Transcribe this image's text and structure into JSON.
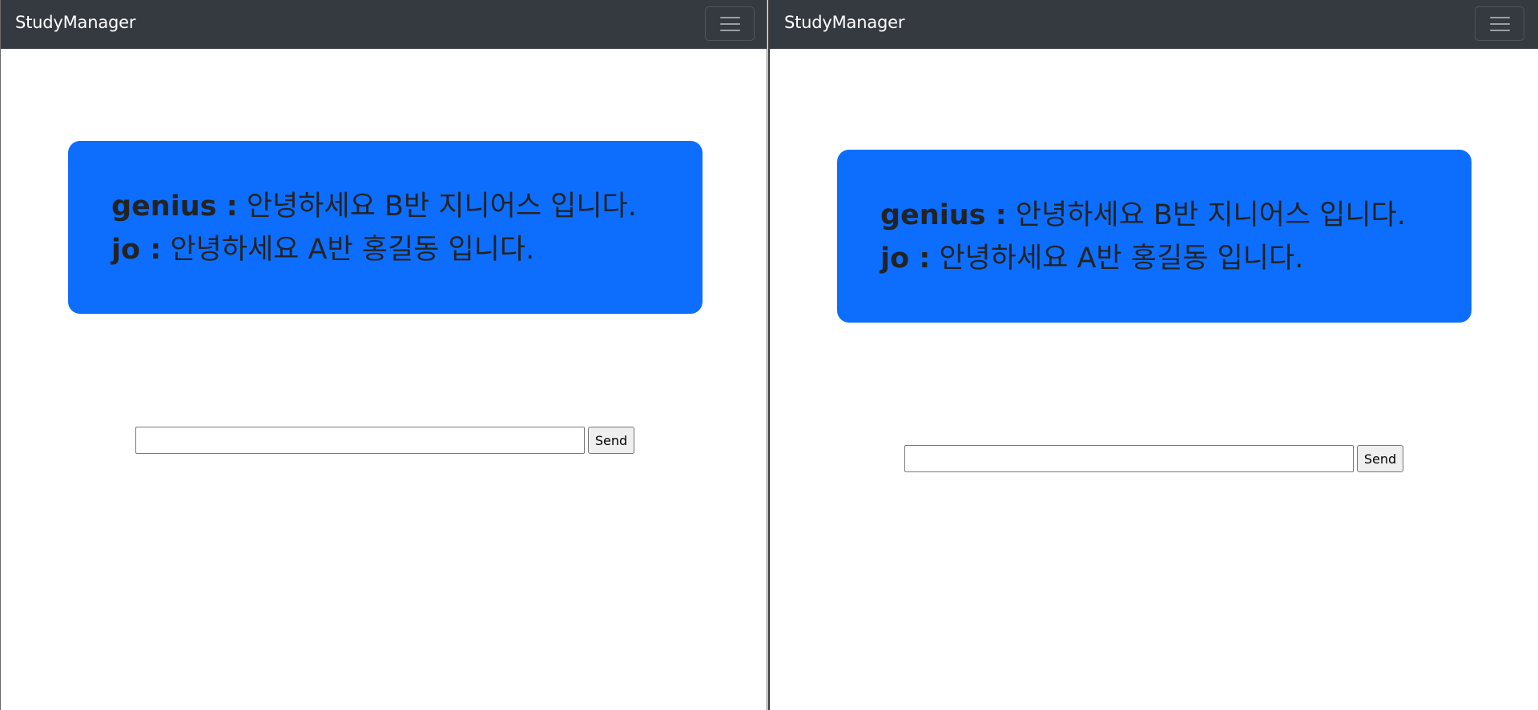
{
  "windows": [
    {
      "navbar": {
        "brand": "StudyManager",
        "toggler_icon": "hamburger-menu-icon"
      },
      "chat": {
        "messages": [
          {
            "user": "genius :",
            "text": " 안녕하세요 B반 지니어스 입니다."
          },
          {
            "user": "jo :",
            "text": " 안녕하세요 A반 홍길동 입니다."
          }
        ]
      },
      "input": {
        "value": "",
        "send_label": "Send"
      }
    },
    {
      "navbar": {
        "brand": "StudyManager",
        "toggler_icon": "hamburger-menu-icon"
      },
      "chat": {
        "messages": [
          {
            "user": "genius :",
            "text": " 안녕하세요 B반 지니어스 입니다."
          },
          {
            "user": "jo :",
            "text": " 안녕하세요 A반 홍길동 입니다."
          }
        ]
      },
      "input": {
        "value": "",
        "send_label": "Send"
      }
    }
  ],
  "colors": {
    "navbar_bg": "#343a40",
    "chat_box_bg": "#0d6efd",
    "message_text": "#232323",
    "brand_text": "#ffffff"
  }
}
